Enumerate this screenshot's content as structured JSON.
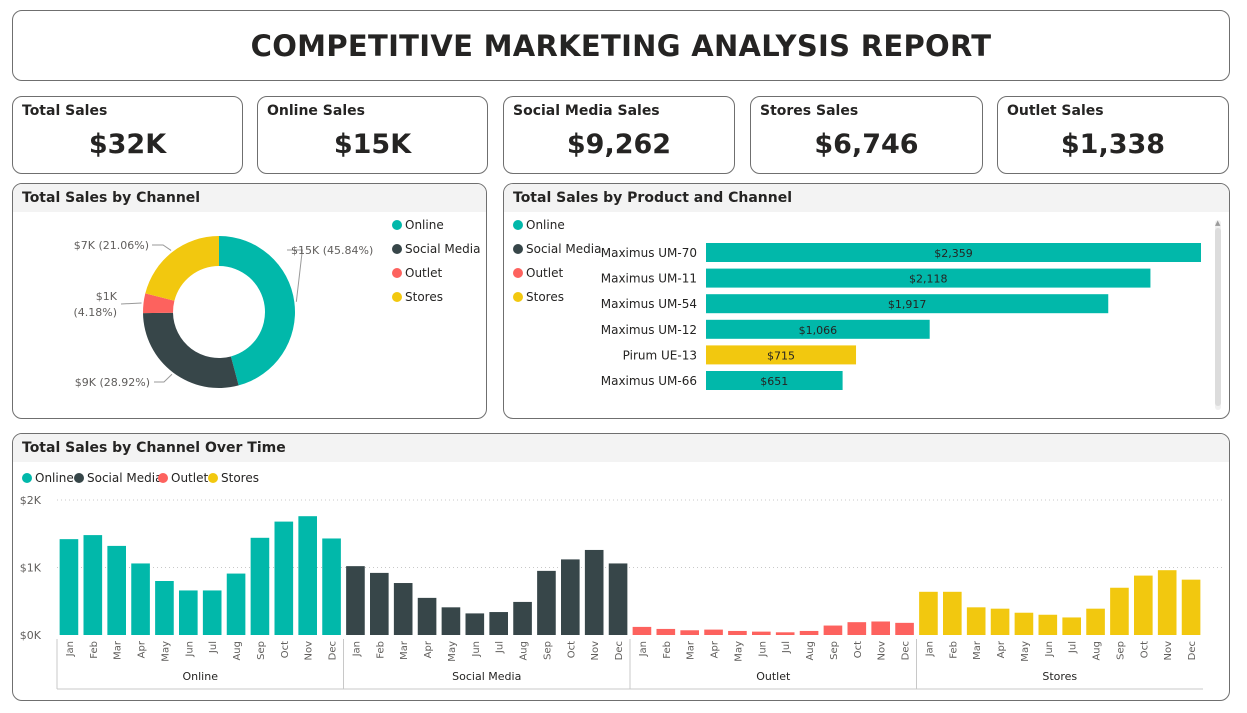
{
  "report": {
    "title": "COMPETITIVE MARKETING ANALYSIS REPORT"
  },
  "kpis": [
    {
      "label": "Total Sales",
      "value": "$32K"
    },
    {
      "label": "Online Sales",
      "value": "$15K"
    },
    {
      "label": "Social Media Sales",
      "value": "$9,262"
    },
    {
      "label": "Stores Sales",
      "value": "$6,746"
    },
    {
      "label": "Outlet Sales",
      "value": "$1,338"
    }
  ],
  "colors": {
    "Online": "#01b8aa",
    "Social Media": "#374649",
    "Outlet": "#fd625e",
    "Stores": "#f2c80f"
  },
  "chart_data": [
    {
      "type": "pie",
      "title": "Total Sales by Channel",
      "legend": [
        "Online",
        "Social Media",
        "Outlet",
        "Stores"
      ],
      "slices": [
        {
          "name": "Online",
          "value": 45.84,
          "label": "$15K (45.84%)"
        },
        {
          "name": "Social Media",
          "value": 28.92,
          "label": "$9K (28.92%)"
        },
        {
          "name": "Outlet",
          "value": 4.18,
          "label_line1": "$1K",
          "label_line2": "(4.18%)"
        },
        {
          "name": "Stores",
          "value": 21.06,
          "label": "$7K (21.06%)"
        }
      ]
    },
    {
      "type": "bar",
      "orientation": "horizontal",
      "title": "Total Sales by Product and Channel",
      "legend": [
        "Online",
        "Social Media",
        "Outlet",
        "Stores"
      ],
      "bars": [
        {
          "category": "Maximus UM-70",
          "value": 2359,
          "label": "$2,359",
          "channel": "Online"
        },
        {
          "category": "Maximus UM-11",
          "value": 2118,
          "label": "$2,118",
          "channel": "Online"
        },
        {
          "category": "Maximus UM-54",
          "value": 1917,
          "label": "$1,917",
          "channel": "Online"
        },
        {
          "category": "Maximus UM-12",
          "value": 1066,
          "label": "$1,066",
          "channel": "Online"
        },
        {
          "category": "Pirum UE-13",
          "value": 715,
          "label": "$715",
          "channel": "Stores"
        },
        {
          "category": "Maximus UM-66",
          "value": 651,
          "label": "$651",
          "channel": "Online"
        }
      ]
    },
    {
      "type": "bar",
      "title": "Total Sales by Channel Over Time",
      "legend": [
        "Online",
        "Social Media",
        "Outlet",
        "Stores"
      ],
      "months": [
        "Jan",
        "Feb",
        "Mar",
        "Apr",
        "May",
        "Jun",
        "Jul",
        "Aug",
        "Sep",
        "Oct",
        "Nov",
        "Dec"
      ],
      "ylim": [
        0,
        2000
      ],
      "yticks": [
        0,
        1000,
        2000
      ],
      "ytick_labels": [
        "$0K",
        "$1K",
        "$2K"
      ],
      "series": [
        {
          "name": "Online",
          "values": [
            1420,
            1480,
            1320,
            1060,
            800,
            660,
            660,
            910,
            1440,
            1680,
            1760,
            1430
          ]
        },
        {
          "name": "Social Media",
          "values": [
            1020,
            920,
            770,
            550,
            410,
            320,
            340,
            490,
            950,
            1120,
            1260,
            1060
          ]
        },
        {
          "name": "Outlet",
          "values": [
            120,
            90,
            70,
            80,
            60,
            50,
            40,
            60,
            140,
            190,
            200,
            180
          ]
        },
        {
          "name": "Stores",
          "values": [
            640,
            640,
            410,
            390,
            330,
            300,
            260,
            390,
            700,
            880,
            960,
            820
          ]
        }
      ]
    }
  ]
}
